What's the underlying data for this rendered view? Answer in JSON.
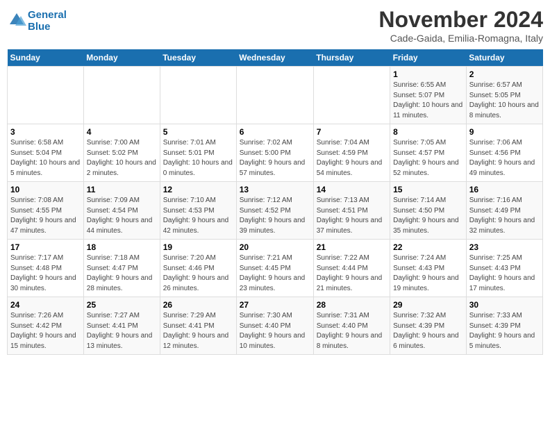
{
  "header": {
    "logo_line1": "General",
    "logo_line2": "Blue",
    "month": "November 2024",
    "location": "Cade-Gaida, Emilia-Romagna, Italy"
  },
  "weekdays": [
    "Sunday",
    "Monday",
    "Tuesday",
    "Wednesday",
    "Thursday",
    "Friday",
    "Saturday"
  ],
  "weeks": [
    [
      {
        "day": "",
        "info": ""
      },
      {
        "day": "",
        "info": ""
      },
      {
        "day": "",
        "info": ""
      },
      {
        "day": "",
        "info": ""
      },
      {
        "day": "",
        "info": ""
      },
      {
        "day": "1",
        "info": "Sunrise: 6:55 AM\nSunset: 5:07 PM\nDaylight: 10 hours and 11 minutes."
      },
      {
        "day": "2",
        "info": "Sunrise: 6:57 AM\nSunset: 5:05 PM\nDaylight: 10 hours and 8 minutes."
      }
    ],
    [
      {
        "day": "3",
        "info": "Sunrise: 6:58 AM\nSunset: 5:04 PM\nDaylight: 10 hours and 5 minutes."
      },
      {
        "day": "4",
        "info": "Sunrise: 7:00 AM\nSunset: 5:02 PM\nDaylight: 10 hours and 2 minutes."
      },
      {
        "day": "5",
        "info": "Sunrise: 7:01 AM\nSunset: 5:01 PM\nDaylight: 10 hours and 0 minutes."
      },
      {
        "day": "6",
        "info": "Sunrise: 7:02 AM\nSunset: 5:00 PM\nDaylight: 9 hours and 57 minutes."
      },
      {
        "day": "7",
        "info": "Sunrise: 7:04 AM\nSunset: 4:59 PM\nDaylight: 9 hours and 54 minutes."
      },
      {
        "day": "8",
        "info": "Sunrise: 7:05 AM\nSunset: 4:57 PM\nDaylight: 9 hours and 52 minutes."
      },
      {
        "day": "9",
        "info": "Sunrise: 7:06 AM\nSunset: 4:56 PM\nDaylight: 9 hours and 49 minutes."
      }
    ],
    [
      {
        "day": "10",
        "info": "Sunrise: 7:08 AM\nSunset: 4:55 PM\nDaylight: 9 hours and 47 minutes."
      },
      {
        "day": "11",
        "info": "Sunrise: 7:09 AM\nSunset: 4:54 PM\nDaylight: 9 hours and 44 minutes."
      },
      {
        "day": "12",
        "info": "Sunrise: 7:10 AM\nSunset: 4:53 PM\nDaylight: 9 hours and 42 minutes."
      },
      {
        "day": "13",
        "info": "Sunrise: 7:12 AM\nSunset: 4:52 PM\nDaylight: 9 hours and 39 minutes."
      },
      {
        "day": "14",
        "info": "Sunrise: 7:13 AM\nSunset: 4:51 PM\nDaylight: 9 hours and 37 minutes."
      },
      {
        "day": "15",
        "info": "Sunrise: 7:14 AM\nSunset: 4:50 PM\nDaylight: 9 hours and 35 minutes."
      },
      {
        "day": "16",
        "info": "Sunrise: 7:16 AM\nSunset: 4:49 PM\nDaylight: 9 hours and 32 minutes."
      }
    ],
    [
      {
        "day": "17",
        "info": "Sunrise: 7:17 AM\nSunset: 4:48 PM\nDaylight: 9 hours and 30 minutes."
      },
      {
        "day": "18",
        "info": "Sunrise: 7:18 AM\nSunset: 4:47 PM\nDaylight: 9 hours and 28 minutes."
      },
      {
        "day": "19",
        "info": "Sunrise: 7:20 AM\nSunset: 4:46 PM\nDaylight: 9 hours and 26 minutes."
      },
      {
        "day": "20",
        "info": "Sunrise: 7:21 AM\nSunset: 4:45 PM\nDaylight: 9 hours and 23 minutes."
      },
      {
        "day": "21",
        "info": "Sunrise: 7:22 AM\nSunset: 4:44 PM\nDaylight: 9 hours and 21 minutes."
      },
      {
        "day": "22",
        "info": "Sunrise: 7:24 AM\nSunset: 4:43 PM\nDaylight: 9 hours and 19 minutes."
      },
      {
        "day": "23",
        "info": "Sunrise: 7:25 AM\nSunset: 4:43 PM\nDaylight: 9 hours and 17 minutes."
      }
    ],
    [
      {
        "day": "24",
        "info": "Sunrise: 7:26 AM\nSunset: 4:42 PM\nDaylight: 9 hours and 15 minutes."
      },
      {
        "day": "25",
        "info": "Sunrise: 7:27 AM\nSunset: 4:41 PM\nDaylight: 9 hours and 13 minutes."
      },
      {
        "day": "26",
        "info": "Sunrise: 7:29 AM\nSunset: 4:41 PM\nDaylight: 9 hours and 12 minutes."
      },
      {
        "day": "27",
        "info": "Sunrise: 7:30 AM\nSunset: 4:40 PM\nDaylight: 9 hours and 10 minutes."
      },
      {
        "day": "28",
        "info": "Sunrise: 7:31 AM\nSunset: 4:40 PM\nDaylight: 9 hours and 8 minutes."
      },
      {
        "day": "29",
        "info": "Sunrise: 7:32 AM\nSunset: 4:39 PM\nDaylight: 9 hours and 6 minutes."
      },
      {
        "day": "30",
        "info": "Sunrise: 7:33 AM\nSunset: 4:39 PM\nDaylight: 9 hours and 5 minutes."
      }
    ]
  ]
}
